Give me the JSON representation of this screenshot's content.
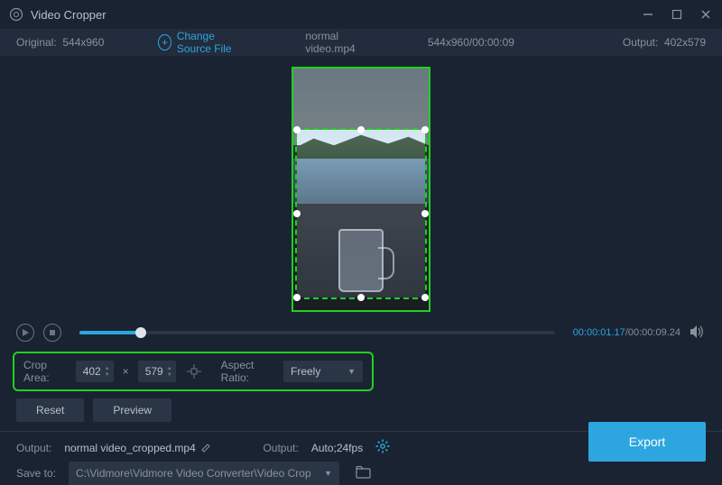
{
  "window": {
    "title": "Video Cropper"
  },
  "infobar": {
    "original_label": "Original:",
    "original_res": "544x960",
    "change_source": "Change Source File",
    "filename": "normal video.mp4",
    "src_info": "544x960/00:00:09",
    "output_label": "Output:",
    "output_res": "402x579"
  },
  "playback": {
    "current": "00:00:01.17",
    "total": "00:00:09.24"
  },
  "crop": {
    "area_label": "Crop Area:",
    "width": "402",
    "height": "579",
    "ratio_label": "Aspect Ratio:",
    "ratio_value": "Freely"
  },
  "buttons": {
    "reset": "Reset",
    "preview": "Preview",
    "export": "Export"
  },
  "output": {
    "file_label": "Output:",
    "file_name": "normal video_cropped.mp4",
    "settings_label": "Output:",
    "settings_value": "Auto;24fps",
    "saveto_label": "Save to:",
    "saveto_path": "C:\\Vidmore\\Vidmore Video Converter\\Video Crop"
  }
}
